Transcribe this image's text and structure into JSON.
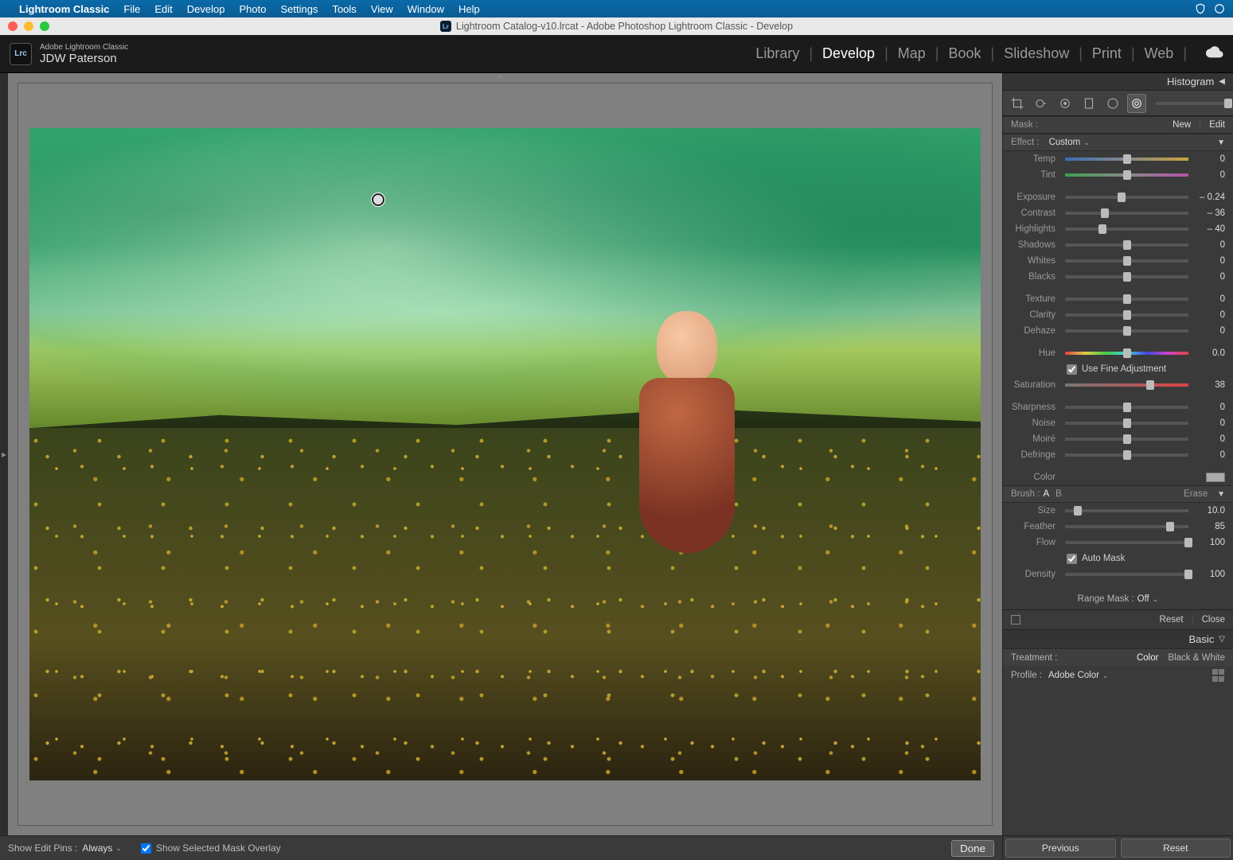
{
  "mac_menu": {
    "app": "Lightroom Classic",
    "items": [
      "File",
      "Edit",
      "Develop",
      "Photo",
      "Settings",
      "Tools",
      "View",
      "Window",
      "Help"
    ]
  },
  "window_title": "Lightroom Catalog-v10.lrcat - Adobe Photoshop Lightroom Classic - Develop",
  "identity": {
    "line1": "Adobe Lightroom Classic",
    "line2": "JDW Paterson",
    "logo": "Lrc"
  },
  "modules": [
    "Library",
    "Develop",
    "Map",
    "Book",
    "Slideshow",
    "Print",
    "Web"
  ],
  "active_module": "Develop",
  "histogram": {
    "title": "Histogram"
  },
  "mask": {
    "label": "Mask :",
    "new": "New",
    "edit": "Edit"
  },
  "effect": {
    "label": "Effect :",
    "value": "Custom"
  },
  "sliders": {
    "temp": {
      "label": "Temp",
      "value": "0",
      "pos": 50
    },
    "tint": {
      "label": "Tint",
      "value": "0",
      "pos": 50
    },
    "exposure": {
      "label": "Exposure",
      "value": "– 0.24",
      "pos": 46
    },
    "contrast": {
      "label": "Contrast",
      "value": "– 36",
      "pos": 32
    },
    "highlights": {
      "label": "Highlights",
      "value": "– 40",
      "pos": 30
    },
    "shadows": {
      "label": "Shadows",
      "value": "0",
      "pos": 50
    },
    "whites": {
      "label": "Whites",
      "value": "0",
      "pos": 50
    },
    "blacks": {
      "label": "Blacks",
      "value": "0",
      "pos": 50
    },
    "texture": {
      "label": "Texture",
      "value": "0",
      "pos": 50
    },
    "clarity": {
      "label": "Clarity",
      "value": "0",
      "pos": 50
    },
    "dehaze": {
      "label": "Dehaze",
      "value": "0",
      "pos": 50
    },
    "hue": {
      "label": "Hue",
      "value": "0.0",
      "pos": 50
    },
    "fine_adj": {
      "label": "Use Fine Adjustment",
      "checked": true
    },
    "saturation": {
      "label": "Saturation",
      "value": "38",
      "pos": 69
    },
    "sharpness": {
      "label": "Sharpness",
      "value": "0",
      "pos": 50
    },
    "noise": {
      "label": "Noise",
      "value": "0",
      "pos": 50
    },
    "moire": {
      "label": "Moiré",
      "value": "0",
      "pos": 50
    },
    "defringe": {
      "label": "Defringe",
      "value": "0",
      "pos": 50
    },
    "color": {
      "label": "Color"
    }
  },
  "brush": {
    "label": "Brush :",
    "tab_a": "A",
    "tab_b": "B",
    "erase": "Erase",
    "size": {
      "label": "Size",
      "value": "10.0",
      "pos": 10
    },
    "feather": {
      "label": "Feather",
      "value": "85",
      "pos": 85
    },
    "flow": {
      "label": "Flow",
      "value": "100",
      "pos": 100
    },
    "automask": {
      "label": "Auto Mask",
      "checked": true
    },
    "density": {
      "label": "Density",
      "value": "100",
      "pos": 100
    }
  },
  "range_mask": {
    "label": "Range Mask :",
    "value": "Off"
  },
  "reset_close": {
    "reset": "Reset",
    "close": "Close"
  },
  "basic": {
    "title": "Basic",
    "treatment": "Treatment :",
    "color": "Color",
    "bw": "Black & White",
    "profile": "Profile :",
    "profile_value": "Adobe Color"
  },
  "footer": {
    "pins_label": "Show Edit Pins :",
    "pins_value": "Always",
    "mask_overlay": "Show Selected Mask Overlay",
    "mask_checked": true,
    "done": "Done",
    "previous": "Previous",
    "reset": "Reset"
  }
}
